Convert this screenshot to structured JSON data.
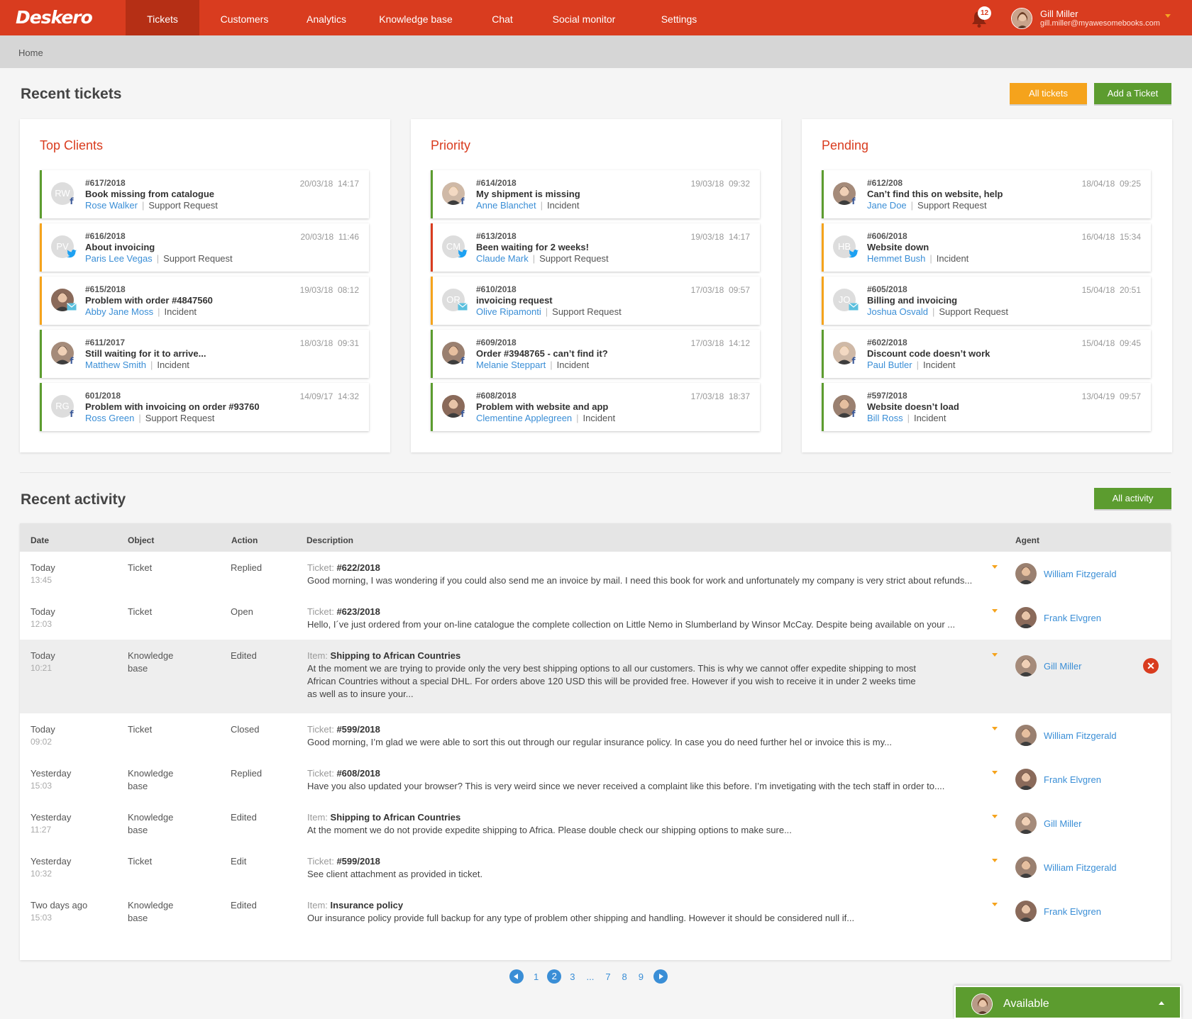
{
  "app": {
    "logo": "Deskero"
  },
  "nav": [
    {
      "label": "Tickets",
      "active": true
    },
    {
      "label": "Customers"
    },
    {
      "label": "Analytics"
    },
    {
      "label": "Knowledge base"
    },
    {
      "label": "Chat"
    },
    {
      "label": "Social monitor"
    },
    {
      "label": "Settings"
    }
  ],
  "header": {
    "notifications": "12",
    "user_name": "Gill Miller",
    "user_email": "gill.miller@myawesomebooks.com"
  },
  "breadcrumb": "Home",
  "recent_tickets": {
    "title": "Recent tickets",
    "all_tickets": "All tickets",
    "add_ticket": "Add a Ticket",
    "panels": [
      {
        "title": "Top Clients",
        "tickets": [
          {
            "num": "#617/2018",
            "subject": "Book missing from catalogue",
            "client": "Rose Walker",
            "type": "Support Request",
            "date": "20/03/18  14:17",
            "initials": "RW",
            "social": "f",
            "status_color": "green"
          },
          {
            "num": "#616/2018",
            "subject": "About invoicing",
            "client": "Paris Lee Vegas",
            "type": "Support Request",
            "date": "20/03/18  11:46",
            "initials": "PV",
            "social": "twitter",
            "status_color": "orange"
          },
          {
            "num": "#615/2018",
            "subject": "Problem with order #4847560",
            "client": "Abby Jane Moss",
            "type": "Incident",
            "date": "19/03/18  08:12",
            "initials": "",
            "social": "email",
            "status_color": "orange"
          },
          {
            "num": "#611/2017",
            "subject": "Still waiting for it to arrive...",
            "client": "Matthew Smith",
            "type": "Incident",
            "date": "18/03/18  09:31",
            "initials": "",
            "social": "f",
            "status_color": "green"
          },
          {
            "num": "601/2018",
            "subject": "Problem with invoicing on order #93760",
            "client": "Ross Green",
            "type": "Support Request",
            "date": "14/09/17  14:32",
            "initials": "RG",
            "social": "f",
            "status_color": "green"
          }
        ]
      },
      {
        "title": "Priority",
        "tickets": [
          {
            "num": "#614/2018",
            "subject": "My shipment is missing",
            "client": "Anne Blanchet",
            "type": "Incident",
            "date": "19/03/18  09:32",
            "initials": "",
            "social": "f",
            "status_color": "green"
          },
          {
            "num": "#613/2018",
            "subject": "Been waiting for 2 weeks!",
            "client": "Claude Mark",
            "type": "Support Request",
            "date": "19/03/18  14:17",
            "initials": "CM",
            "social": "twitter",
            "status_color": "red"
          },
          {
            "num": "#610/2018",
            "subject": "invoicing request",
            "client": "Olive Ripamonti",
            "type": "Support Request",
            "date": "17/03/18  09:57",
            "initials": "OR",
            "social": "email",
            "status_color": "orange"
          },
          {
            "num": "#609/2018",
            "subject": "Order #3948765 - can’t find it?",
            "client": "Melanie Steppart",
            "type": "Incident",
            "date": "17/03/18  14:12",
            "initials": "",
            "social": "f",
            "status_color": "green"
          },
          {
            "num": "#608/2018",
            "subject": "Problem with website and app",
            "client": "Clementine Applegreen",
            "type": "Incident",
            "date": "17/03/18  18:37",
            "initials": "",
            "social": "f",
            "status_color": "green"
          }
        ]
      },
      {
        "title": "Pending",
        "tickets": [
          {
            "num": "#612/208",
            "subject": "Can’t find this on website, help",
            "client": "Jane Doe",
            "type": "Support Request",
            "date": "18/04/18  09:25",
            "initials": "",
            "social": "f",
            "status_color": "green"
          },
          {
            "num": "#606/2018",
            "subject": "Website down",
            "client": "Hemmet Bush",
            "type": "Incident",
            "date": "16/04/18  15:34",
            "initials": "HB",
            "social": "twitter",
            "status_color": "orange"
          },
          {
            "num": "#605/2018",
            "subject": "Billing and invoicing",
            "client": "Joshua Osvald",
            "type": "Support Request",
            "date": "15/04/18  20:51",
            "initials": "JO",
            "social": "email",
            "status_color": "orange"
          },
          {
            "num": "#602/2018",
            "subject": "Discount code doesn’t work",
            "client": "Paul Butler",
            "type": "Incident",
            "date": "15/04/18  09:45",
            "initials": "",
            "social": "f",
            "status_color": "green"
          },
          {
            "num": "#597/2018",
            "subject": "Website doesn’t load",
            "client": "Bill Ross",
            "type": "Incident",
            "date": "13/04/19  09:57",
            "initials": "",
            "social": "f",
            "status_color": "green"
          }
        ]
      }
    ]
  },
  "recent_activity": {
    "title": "Recent activity",
    "all_activity": "All activity",
    "columns": [
      "Date",
      "Object",
      "Action",
      "Description",
      "Agent"
    ],
    "rows": [
      {
        "date": "Today",
        "time": "13:45",
        "object": "Ticket",
        "action": "Replied",
        "label_key": "Ticket:",
        "label_val": "#622/2018",
        "desc": "Good morning, I was wondering if you could also send me an invoice by mail. I need this book for work and unfortunately my company is very strict about refunds...",
        "agent": "William Fitzgerald"
      },
      {
        "date": "Today",
        "time": "12:03",
        "object": "Ticket",
        "action": "Open",
        "label_key": "Ticket:",
        "label_val": "#623/2018",
        "desc": "Hello, I´ve just ordered from your on-line catalogue the complete collection on Little Nemo in Slumberland by Winsor McCay. Despite being available on your ...",
        "agent": "Frank Elvgren"
      },
      {
        "date": "Today",
        "time": "10:21",
        "object": "Knowledge base",
        "action": "Edited",
        "label_key": "Item:",
        "label_val": "Shipping to African Countries",
        "desc": "At the moment we are trying to provide only the very best shipping options to all our customers. This is why we cannot offer expedite shipping to most African Countries without a special DHL. For orders above 120 USD this will be provided free. However if you wish to receive it in under 2 weeks time as well as to insure your...",
        "agent": "Gill Miller"
      },
      {
        "date": "Today",
        "time": "09:02",
        "object": "Ticket",
        "action": "Closed",
        "label_key": "Ticket:",
        "label_val": "#599/2018",
        "desc": "Good morning, I’m glad we were able to sort this out through our regular insurance policy. In case you do need further hel or invoice this is my...",
        "agent": "William Fitzgerald"
      },
      {
        "date": "Yesterday",
        "time": "15:03",
        "object": "Knowledge base",
        "action": "Replied",
        "label_key": "Ticket:",
        "label_val": "#608/2018",
        "desc": "Have you also updated your browser? This is very weird since we never received a complaint like this before. I’m invetigating with the tech staff in order to....",
        "agent": "Frank Elvgren"
      },
      {
        "date": "Yesterday",
        "time": "11:27",
        "object": "Knowledge base",
        "action": "Edited",
        "label_key": "Item:",
        "label_val": "Shipping to African Countries",
        "desc": "At the moment we do not provide expedite shipping to Africa. Please double check our shipping options to make sure...",
        "agent": "Gill Miller"
      },
      {
        "date": "Yesterday",
        "time": "10:32",
        "object": "Ticket",
        "action": "Edit",
        "label_key": "Ticket:",
        "label_val": "#599/2018",
        "desc": "See client attachment as provided in ticket.",
        "agent": "William Fitzgerald"
      },
      {
        "date": "Two days ago",
        "time": "15:03",
        "object": "Knowledge base",
        "action": "Edited",
        "label_key": "Item:",
        "label_val": "Insurance policy",
        "desc": "Our insurance policy provide full backup for any type of problem other shipping and handling. However it should be considered null if...",
        "agent": "Frank Elvgren"
      }
    ]
  },
  "pagination": {
    "pages": [
      "1",
      "2",
      "3",
      "...",
      "7",
      "8",
      "9"
    ],
    "current": "2"
  },
  "status": {
    "label": "Available"
  },
  "colors": {
    "brand": "#d93c1f",
    "green": "#5c9c2f",
    "orange": "#f5a31c",
    "link": "#3a8ed6"
  },
  "icons": [
    "bell-icon",
    "facebook-icon",
    "twitter-icon",
    "email-icon",
    "chevron-left-icon",
    "chevron-right-icon",
    "close-icon",
    "caret-down-icon"
  ]
}
